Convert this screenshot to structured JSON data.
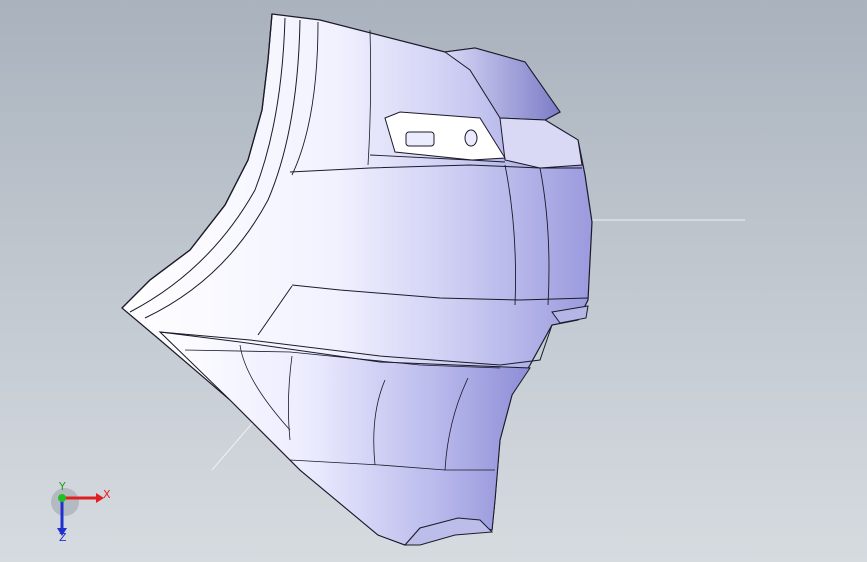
{
  "viewport": {
    "background_top": "#a9b2bd",
    "background_bottom": "#d6dbe0"
  },
  "model": {
    "name": "bumper-part",
    "face_color_light": "#f4f4ff",
    "face_color_mid": "#c9c9f2",
    "face_color_dark": "#8f8fd8",
    "edge_color": "#1a1a2a"
  },
  "triad": {
    "x_label": "X",
    "y_label": "Y",
    "z_label": "Z",
    "x_color": "#e02020",
    "y_color": "#20a020",
    "z_color": "#2030d0"
  }
}
